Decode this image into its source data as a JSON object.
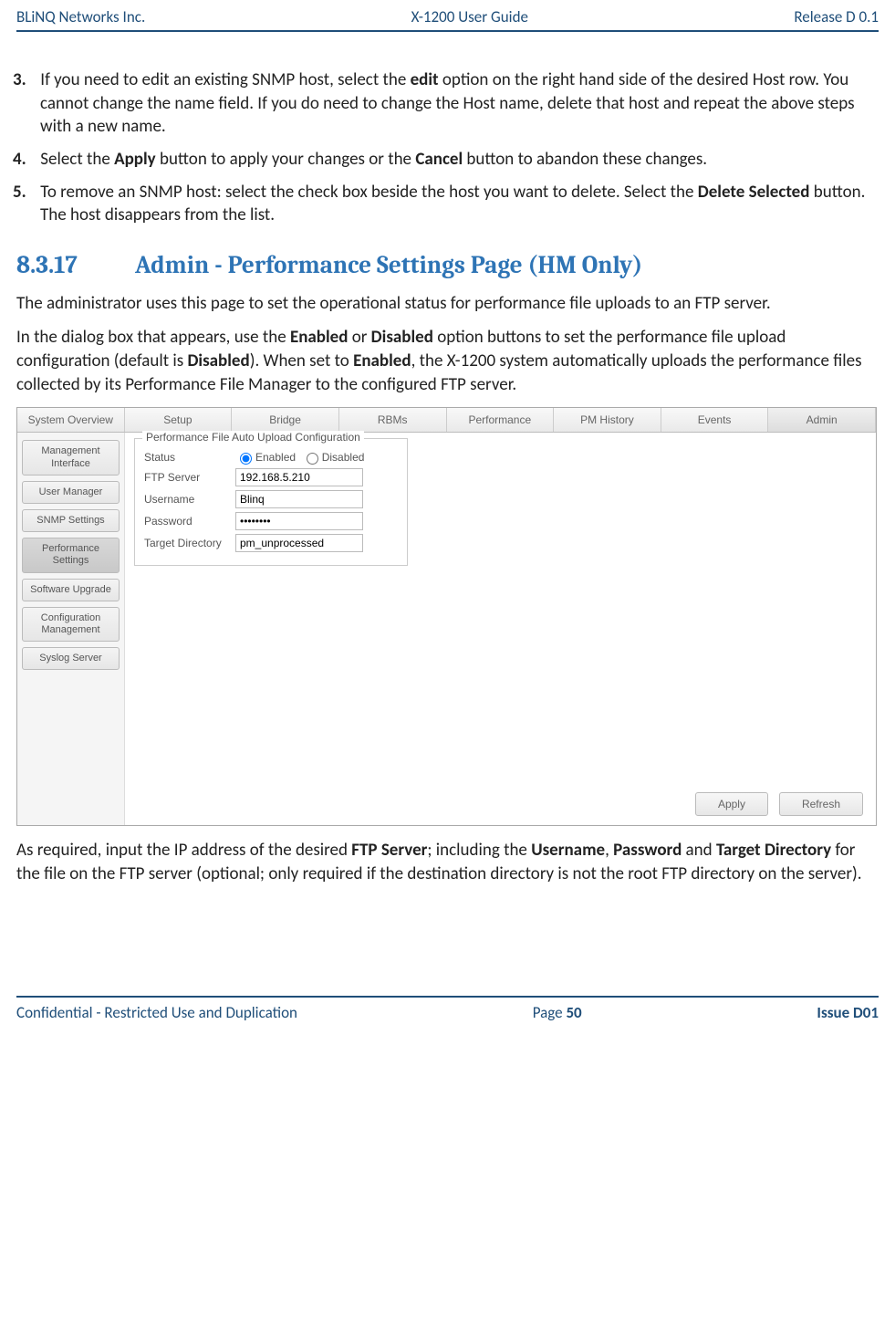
{
  "header": {
    "left": "BLiNQ Networks Inc.",
    "center": "X-1200 User Guide",
    "right": "Release D 0.1"
  },
  "steps": {
    "s3": {
      "num": "3.",
      "t1": "If you need to edit an existing SNMP host, select the ",
      "b1": "edit",
      "t2": " option on the right hand side of the desired Host row. You cannot change the name field. If you do need to change the Host name, delete that host and repeat the above steps with a new name."
    },
    "s4": {
      "num": "4.",
      "t1": "Select the ",
      "b1": "Apply",
      "t2": " button to apply your changes or the ",
      "b2": "Cancel",
      "t3": " button to abandon these changes."
    },
    "s5": {
      "num": "5.",
      "t1": "To remove an SNMP host: select the check box beside the host you want to delete. Select the ",
      "b1": "Delete Selected",
      "t2": " button. The host disappears from the list."
    }
  },
  "heading": {
    "num": "8.3.17",
    "title": "Admin - Performance Settings Page (HM Only)"
  },
  "para1": "The administrator uses this page to set the operational status for performance file uploads to an FTP server.",
  "para2": {
    "t1": "In the dialog box that appears, use the ",
    "b1": "Enabled",
    "t2": " or ",
    "b2": "Disabled",
    "t3": " option buttons to set the performance file upload configuration (default is ",
    "b3": "Disabled",
    "t4": "). When set to ",
    "b4": "Enabled",
    "t5": ", the X-1200 system automatically uploads the performance files collected by its Performance File Manager to the configured FTP server."
  },
  "app": {
    "tabs": [
      "System Overview",
      "Setup",
      "Bridge",
      "RBMs",
      "Performance",
      "PM History",
      "Events",
      "Admin"
    ],
    "sidebar": [
      "Management Interface",
      "User Manager",
      "SNMP Settings",
      "Performance Settings",
      "Software Upgrade",
      "Configuration Management",
      "Syslog Server"
    ],
    "sidebarActiveIndex": 3,
    "legend": "Performance File Auto Upload Configuration",
    "fields": {
      "status_label": "Status",
      "enabled_label": "Enabled",
      "disabled_label": "Disabled",
      "ftp_label": "FTP Server",
      "ftp_value": "192.168.5.210",
      "user_label": "Username",
      "user_value": "Blinq",
      "pass_label": "Password",
      "pass_value": "••••••••",
      "dir_label": "Target Directory",
      "dir_value": "pm_unprocessed"
    },
    "buttons": {
      "apply": "Apply",
      "refresh": "Refresh"
    }
  },
  "para3": {
    "t1": "As required, input the IP address of the desired ",
    "b1": "FTP Server",
    "t2": "; including the ",
    "b2": "Username",
    "t3": ", ",
    "b3": "Password",
    "t4": " and ",
    "b4": "Target Directory",
    "t5": " for the file on the FTP server (optional; only required if the destination directory is not the root FTP directory on the server)."
  },
  "footer": {
    "left": "Confidential - Restricted Use and Duplication",
    "page_prefix": "Page ",
    "page_num": "50",
    "issue": "Issue D01"
  }
}
